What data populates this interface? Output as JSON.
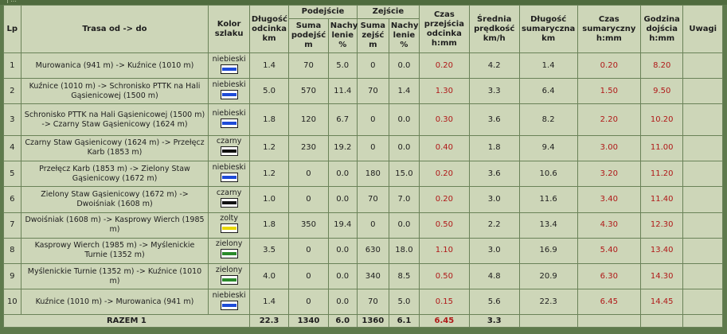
{
  "colors": {
    "niebieski": "#1e4bd8",
    "czarny": "#111111",
    "zolty": "#e8d800",
    "zielony": "#2a8a2a",
    "accent_red": "#b01818"
  },
  "header": {
    "lp": "Lp",
    "trasa": "Trasa od -> do",
    "kolor": "Kolor szlaku",
    "dlugosc": "Długość odcinka km",
    "podejscie": "Podejście",
    "zejscie": "Zejście",
    "suma_podejsc": "Suma podejść m",
    "nachylenie_pod": "Nachy lenie %",
    "suma_zejsc": "Suma zejść m",
    "nachylenie_zej": "Nachy lenie %",
    "czas": "Czas przejścia odcinka h:mm",
    "srednia": "Średnia prędkość km/h",
    "dlugosc_sum": "Długość sumaryczna km",
    "czas_sum": "Czas sumaryczny h:mm",
    "godzina": "Godzina dojścia h:mm",
    "uwagi": "Uwagi"
  },
  "rows": [
    {
      "lp": "1",
      "trasa": "Murowanica (941 m) -> Kuźnice (1010 m)",
      "kolor": "niebieski",
      "km": "1.4",
      "pod": "70",
      "nach_pod": "5.0",
      "zej": "0",
      "nach_zej": "0.0",
      "czas": "0.20",
      "predkosc": "4.2",
      "km_sum": "1.4",
      "czas_sum": "0.20",
      "godzina": "8.20",
      "uwagi": ""
    },
    {
      "lp": "2",
      "trasa": "Kuźnice (1010 m) -> Schronisko PTTK na Hali Gąsienicowej (1500 m)",
      "kolor": "niebieski",
      "km": "5.0",
      "pod": "570",
      "nach_pod": "11.4",
      "zej": "70",
      "nach_zej": "1.4",
      "czas": "1.30",
      "predkosc": "3.3",
      "km_sum": "6.4",
      "czas_sum": "1.50",
      "godzina": "9.50",
      "uwagi": ""
    },
    {
      "lp": "3",
      "trasa": "Schronisko PTTK na Hali Gąsienicowej (1500 m) -> Czarny Staw Gąsienicowy (1624 m)",
      "kolor": "niebieski",
      "km": "1.8",
      "pod": "120",
      "nach_pod": "6.7",
      "zej": "0",
      "nach_zej": "0.0",
      "czas": "0.30",
      "predkosc": "3.6",
      "km_sum": "8.2",
      "czas_sum": "2.20",
      "godzina": "10.20",
      "uwagi": ""
    },
    {
      "lp": "4",
      "trasa": "Czarny Staw Gąsienicowy (1624 m) -> Przełęcz Karb (1853 m)",
      "kolor": "czarny",
      "km": "1.2",
      "pod": "230",
      "nach_pod": "19.2",
      "zej": "0",
      "nach_zej": "0.0",
      "czas": "0.40",
      "predkosc": "1.8",
      "km_sum": "9.4",
      "czas_sum": "3.00",
      "godzina": "11.00",
      "uwagi": ""
    },
    {
      "lp": "5",
      "trasa": "Przełęcz Karb (1853 m) -> Zielony Staw Gąsienicowy (1672 m)",
      "kolor": "niebieski",
      "km": "1.2",
      "pod": "0",
      "nach_pod": "0.0",
      "zej": "180",
      "nach_zej": "15.0",
      "czas": "0.20",
      "predkosc": "3.6",
      "km_sum": "10.6",
      "czas_sum": "3.20",
      "godzina": "11.20",
      "uwagi": ""
    },
    {
      "lp": "6",
      "trasa": "Zielony Staw Gąsienicowy (1672 m) -> Dwoiśniak (1608 m)",
      "kolor": "czarny",
      "km": "1.0",
      "pod": "0",
      "nach_pod": "0.0",
      "zej": "70",
      "nach_zej": "7.0",
      "czas": "0.20",
      "predkosc": "3.0",
      "km_sum": "11.6",
      "czas_sum": "3.40",
      "godzina": "11.40",
      "uwagi": ""
    },
    {
      "lp": "7",
      "trasa": "Dwoiśniak (1608 m) -> Kasprowy Wierch (1985 m)",
      "kolor": "zolty",
      "km": "1.8",
      "pod": "350",
      "nach_pod": "19.4",
      "zej": "0",
      "nach_zej": "0.0",
      "czas": "0.50",
      "predkosc": "2.2",
      "km_sum": "13.4",
      "czas_sum": "4.30",
      "godzina": "12.30",
      "uwagi": ""
    },
    {
      "lp": "8",
      "trasa": "Kasprowy Wierch (1985 m) -> Myślenickie Turnie (1352 m)",
      "kolor": "zielony",
      "km": "3.5",
      "pod": "0",
      "nach_pod": "0.0",
      "zej": "630",
      "nach_zej": "18.0",
      "czas": "1.10",
      "predkosc": "3.0",
      "km_sum": "16.9",
      "czas_sum": "5.40",
      "godzina": "13.40",
      "uwagi": ""
    },
    {
      "lp": "9",
      "trasa": "Myślenickie Turnie (1352 m) -> Kuźnice (1010 m)",
      "kolor": "zielony",
      "km": "4.0",
      "pod": "0",
      "nach_pod": "0.0",
      "zej": "340",
      "nach_zej": "8.5",
      "czas": "0.50",
      "predkosc": "4.8",
      "km_sum": "20.9",
      "czas_sum": "6.30",
      "godzina": "14.30",
      "uwagi": ""
    },
    {
      "lp": "10",
      "trasa": "Kuźnice (1010 m) -> Murowanica (941 m)",
      "kolor": "niebieski",
      "km": "1.4",
      "pod": "0",
      "nach_pod": "0.0",
      "zej": "70",
      "nach_zej": "5.0",
      "czas": "0.15",
      "predkosc": "5.6",
      "km_sum": "22.3",
      "czas_sum": "6.45",
      "godzina": "14.45",
      "uwagi": ""
    }
  ],
  "total": {
    "label": "RAZEM 1",
    "km": "22.3",
    "pod": "1340",
    "nach_pod": "6.0",
    "zej": "1360",
    "nach_zej": "6.1",
    "czas": "6.45",
    "predkosc": "3.3"
  }
}
